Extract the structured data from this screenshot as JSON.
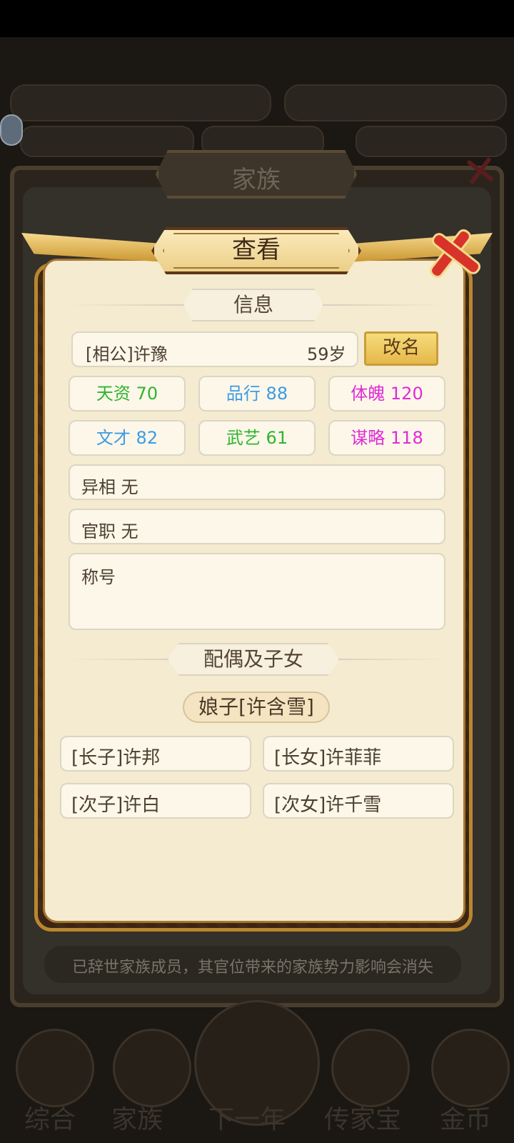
{
  "background": {
    "outer_title": "家族",
    "notice": "已辞世家族成员，其官位带来的家族势力影响会消失",
    "nav": [
      "综合",
      "家族",
      "下一年",
      "传家宝",
      "金币"
    ]
  },
  "dialog": {
    "title": "查看",
    "info_header": "信息",
    "person": {
      "name": "[相公]许豫",
      "age": "59岁"
    },
    "rename_label": "改名",
    "stats": [
      {
        "label": "天资",
        "value": "70",
        "color": "#2fb52f"
      },
      {
        "label": "品行",
        "value": "88",
        "color": "#3d9be3"
      },
      {
        "label": "体魄",
        "value": "120",
        "color": "#e12bd9"
      },
      {
        "label": "文才",
        "value": "82",
        "color": "#3d9be3"
      },
      {
        "label": "武艺",
        "value": "61",
        "color": "#2fb52f"
      },
      {
        "label": "谋略",
        "value": "118",
        "color": "#e12bd9"
      }
    ],
    "trait": {
      "label": "异相",
      "value": "无"
    },
    "office": {
      "label": "官职",
      "value": "无"
    },
    "titles_label": "称号",
    "family_header": "配偶及子女",
    "spouse": "娘子[许含雪]",
    "children": [
      "[长子]许邦",
      "[长女]许菲菲",
      "[次子]许白",
      "[次女]许千雪"
    ]
  }
}
